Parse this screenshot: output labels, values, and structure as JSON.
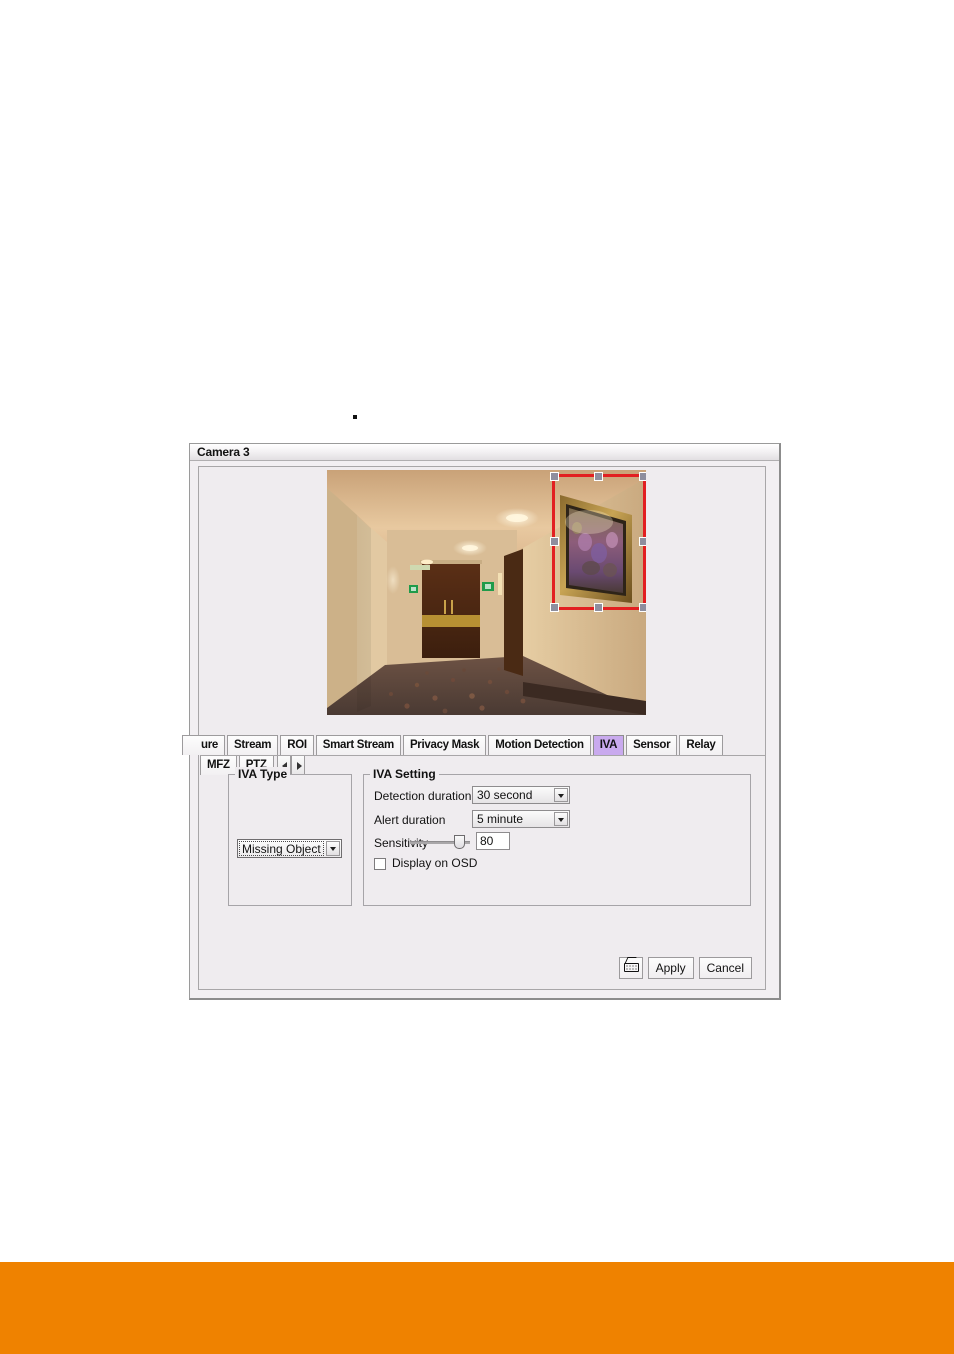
{
  "window": {
    "title": "Camera 3"
  },
  "video": {
    "alt": "hotel-hallway-camera-preview",
    "roi": {
      "label": "missing-object-region"
    }
  },
  "tabs": [
    {
      "label": "ure",
      "selected": false,
      "clipped": true
    },
    {
      "label": "Stream",
      "selected": false
    },
    {
      "label": "ROI",
      "selected": false
    },
    {
      "label": "Smart Stream",
      "selected": false
    },
    {
      "label": "Privacy Mask",
      "selected": false
    },
    {
      "label": "Motion Detection",
      "selected": false
    },
    {
      "label": "IVA",
      "selected": true
    },
    {
      "label": "Sensor",
      "selected": false
    },
    {
      "label": "Relay",
      "selected": false
    },
    {
      "label": "MFZ",
      "selected": false
    },
    {
      "label": "PTZ",
      "selected": false
    }
  ],
  "iva_type": {
    "legend": "IVA Type",
    "selected": "Missing Object"
  },
  "iva_setting": {
    "legend": "IVA Setting",
    "detection_duration": {
      "label": "Detection duration",
      "value": "30 second"
    },
    "alert_duration": {
      "label": "Alert duration",
      "value": "5 minute"
    },
    "sensitivity": {
      "label": "Sensitivity",
      "value": "80"
    },
    "display_on_osd": {
      "label": "Display on OSD",
      "checked": false
    }
  },
  "buttons": {
    "keyboard_icon": "keyboard-icon",
    "apply": "Apply",
    "cancel": "Cancel"
  },
  "colors": {
    "tab_selected": "#c9aaee",
    "roi_rect": "#e21f21",
    "footer": "#ef8200",
    "panel_bg": "#efecef"
  }
}
